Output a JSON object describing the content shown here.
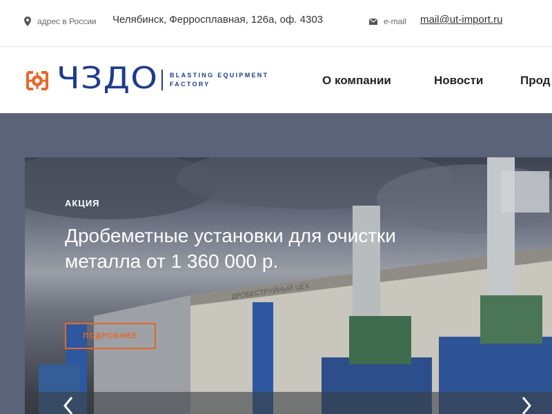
{
  "topbar": {
    "region_label": "адрес в России",
    "address": "Челябинск, Ферросплавная, 126а, оф. 4303",
    "email_label": "e-mail",
    "email": "mail@ut-import.ru"
  },
  "header": {
    "logo_text": "ЧЗДО",
    "logo_tagline_1": "BLASTING EQUIPMENT",
    "logo_tagline_2": "FACTORY",
    "nav": [
      "О компании",
      "Новости",
      "Прод"
    ]
  },
  "hero": {
    "label": "АКЦИЯ",
    "title": "Дробеметные установки для очистки металла от 1 360 000 р.",
    "button": "ПОДРОБНЕЕ",
    "building_sign": "ДРОБЕСТРУЙНЫЙ ЦЕХ"
  },
  "colors": {
    "brand_blue": "#1f3b8e",
    "accent_orange": "#e8672c",
    "hero_overlay": "#5a6377"
  },
  "icons": [
    "map-pin-icon",
    "envelope-icon",
    "logo-gear-icon",
    "chevron-left-icon",
    "chevron-right-icon"
  ]
}
